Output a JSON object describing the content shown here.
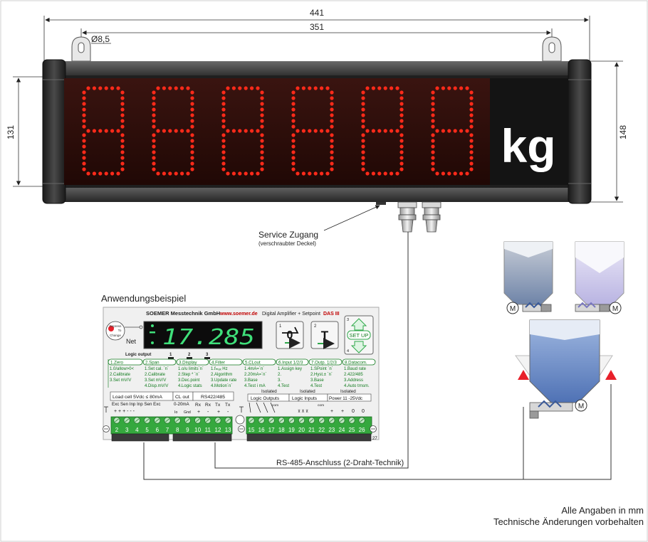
{
  "dimensions": {
    "total_width": "441",
    "inner_width": "351",
    "hole_diameter": "Ø8,5",
    "height_left": "131",
    "height_right": "148"
  },
  "display": {
    "unit": "kg",
    "digits": [
      "8",
      "8",
      "8",
      "8",
      "8",
      "8"
    ]
  },
  "service": {
    "title": "Service Zugang",
    "subtitle": "(verschraubter Deckel)"
  },
  "example": {
    "title": "Anwendungsbeispiel",
    "header_company": "SOEMER Messtechnik GmbH",
    "header_url": "www.soemer.de",
    "header_desc": "Digital Amplifier + Setpoint",
    "header_model": "DAS III",
    "knob_labels": [
      "Depress",
      "To",
      "Change"
    ],
    "net_label": "Net",
    "reading": "17.285",
    "keys": {
      "k1_num": "1",
      "k2_num": "2",
      "k2_label": "T",
      "k3_num": "3",
      "k4_num": "4",
      "setup": "SET UP"
    },
    "logic_output": {
      "label": "Logic output",
      "n1": "1",
      "n2": "2",
      "n3": "3"
    },
    "menu": [
      {
        "head": "1.Zero",
        "items": [
          "1.0/allow>0<",
          "2.Calibrate",
          "3.Set mV/V"
        ]
      },
      {
        "head": "2.Span",
        "items": [
          "1.Set cal. ´n´",
          "2.Calibrate",
          "3.Set mV/V",
          "4.Disp.mV/V"
        ]
      },
      {
        "head": "3.Display",
        "items": [
          "1.o/u limits´n´",
          "2.Step * ´n´",
          "3.Dec.point",
          "4.Logic stats"
        ]
      },
      {
        "head": "4.Filter",
        "items": [
          "1.fₘₐₓ Hz",
          "2.Algorithm",
          "3.Update rate",
          "4.Motion´n´"
        ]
      },
      {
        "head": "5.CLout",
        "items": [
          "1.4mA=´n´",
          "2.20mA=´n´",
          "3.Base",
          "4.Test i mA"
        ]
      },
      {
        "head": "6.Input 1/2/3",
        "items": [
          "1.Assign key",
          "2.",
          "3.",
          "4.Test"
        ]
      },
      {
        "head": "7.Outp. 1/2/3",
        "items": [
          "1.SPoint ´n´",
          "2.Hyst.± ´n´",
          "3.Base",
          "4.Test"
        ]
      },
      {
        "head": "8.Datacom.",
        "items": [
          "1.Baud rate",
          "2.422/485",
          "3.Address",
          "4.Auto trnsm."
        ]
      }
    ],
    "terminals": {
      "loadcell": "Load cell  5Vdc ≤ 80mA",
      "loadcell_labels": "Exc Sen Inp Inp Sen Exc",
      "loadcell_signs": "+ +  +  -  -  -",
      "clout": "CL out",
      "clout_range": "0-20mA",
      "clout_sub": [
        "Io",
        "Gnd"
      ],
      "rs": "RS422/485",
      "rs_labels": [
        "Rx",
        "Rx",
        "Tx",
        "Tx"
      ],
      "rs_signs": [
        "+",
        "-",
        "+",
        "-"
      ],
      "isolated": "Isolated",
      "logic_outputs": "Logic Outputs",
      "logic_inputs": "Logic Inputs",
      "power": "Power 11 -25Vdc",
      "com": "com",
      "numbers_left": [
        "2",
        "3",
        "4",
        "5",
        "6",
        "7",
        "8",
        "9",
        "10",
        "11",
        "12",
        "13"
      ],
      "numbers_right": [
        "15",
        "16",
        "17",
        "18",
        "19",
        "20",
        "21",
        "22",
        "23",
        "24",
        "25",
        "26"
      ],
      "extra_27": "27"
    }
  },
  "rs485_label": "RS-485-Anschluss (2-Draht-Technik)",
  "footer": {
    "line1": "Alle Angaben in mm",
    "line2": "Technische Änderungen vorbehalten"
  },
  "colors": {
    "led_on": "#ff2a1a",
    "led_bg": "#2e0d0a",
    "housing": "#2b2b2b",
    "lcd_green": "#3fe07a",
    "menu_green": "#0f7a1c",
    "terminal_green": "#35a83e",
    "hopper_blue": "#7f9fd0",
    "hopper_lavender": "#d9d6f0",
    "marker_red": "#e8202a"
  }
}
